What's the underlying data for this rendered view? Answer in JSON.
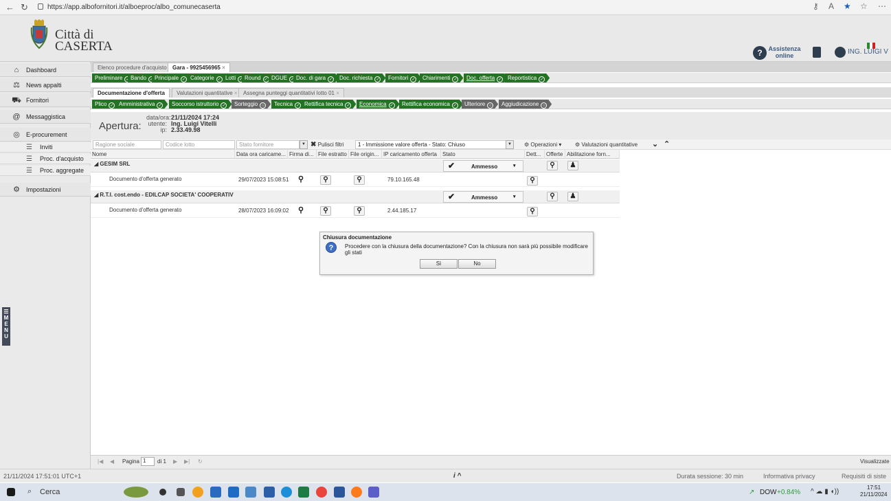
{
  "browser": {
    "url": "https://app.alboformitori.it/alboeproc/albo_comunecaserta",
    "url_display": "https://app.albofornitori.it/alboeproc/albo_comunecaserta"
  },
  "header": {
    "city_line1": "Città di",
    "city_line2": "CASERTA",
    "help_line1": "Assistenza",
    "help_line2": "online",
    "user": "ING. LUIGI V"
  },
  "sidebar": {
    "items": [
      {
        "label": "Dashboard",
        "icon": "home-icon"
      },
      {
        "label": "News appalti",
        "icon": "scales-icon"
      },
      {
        "label": "Fornitori",
        "icon": "truck-icon"
      },
      {
        "label": "Messaggistica",
        "icon": "at-icon"
      },
      {
        "label": "E-procurement",
        "icon": "coins-icon"
      }
    ],
    "subitems": [
      {
        "label": "Inviti"
      },
      {
        "label": "Proc. d'acquisto"
      },
      {
        "label": "Proc. aggregate"
      }
    ],
    "settings": "Impostazioni",
    "menu_tab": "M\nE\nN\nU"
  },
  "tabs1": {
    "t1": "Elenco procedure d'acquisto",
    "t2": "Gara - 9925456965",
    "close": "×"
  },
  "steps1": [
    "Preliminare",
    "Bando",
    "Principale",
    "Categorie",
    "Lotti",
    "Round",
    "DGUE",
    "Doc. di gara",
    "Doc. richiesta",
    "Fornitori",
    "Chiarimenti",
    "Doc. offerta",
    "Reportistica"
  ],
  "tabs2": {
    "t1": "Documentazione d'offerta",
    "t2": "Valutazioni quantitative",
    "t3": "Assegna punteggi quantitativi lotto 01",
    "close": "×"
  },
  "steps2": [
    "Plico",
    "Amministrativa",
    "Soccorso istruttorio",
    "Sorteggio",
    "Tecnica",
    "Rettifica tecnica",
    "Economica",
    "Rettifica economica",
    "Ulteriore",
    "Aggiudicazione"
  ],
  "apertura": {
    "label": "Apertura:",
    "k1": "data/ora:",
    "v1": "21/11/2024 17:24",
    "k2": "utente:",
    "v2": "Ing. Luigi Vitelli",
    "k3": "ip:",
    "v3": "2.33.49.98"
  },
  "filters": {
    "ragione": "Ragione sociale",
    "codice": "Codice lotto",
    "stato": "Stato fornitore",
    "pulisci": "Pulisci filtri",
    "fase": "1 - Immissione valore offerta - Stato: Chiuso",
    "operazioni": "Operazioni",
    "valutazioni": "Valutazioni quantitative"
  },
  "columns": [
    "Nome",
    "Data ora caricame...",
    "Firma di...",
    "File estratto",
    "File origin...",
    "IP caricamento offerta",
    "Stato",
    "Dett...",
    "Offerte",
    "Abilitazione forn..."
  ],
  "groups": [
    {
      "title": "GESIM SRL",
      "status": "Ammesso",
      "doc": "Documento d'offerta generato",
      "date": "29/07/2023 15:08:51",
      "ip": "79.10.165.48"
    },
    {
      "title": "R.T.I. cost.endo - EDILCAP SOCIETA' COOPERATIV",
      "status": "Ammesso",
      "doc": "Documento d'offerta generato",
      "date": "28/07/2023 16:09:02",
      "ip": "2.44.185.17"
    }
  ],
  "dialog": {
    "title": "Chiusura documentazione",
    "text": "Procedere con la chiusura della documentazione? Con la chiusura non sarà più possibile modificare gli stati",
    "yes": "Sì",
    "no": "No"
  },
  "pager": {
    "pagina": "Pagina",
    "page": "1",
    "di": "di 1",
    "visual": "Visualizzate"
  },
  "status": {
    "timestamp": "21/11/2024 17:51:01 UTC+1",
    "info": "i",
    "durata": "Durata sessione: 30 min",
    "privacy": "Informativa privacy",
    "requisiti": "Requisiti di siste"
  },
  "taskbar": {
    "search": "Cerca",
    "dow": "DOW",
    "dow_change": "+0.84%",
    "time": "17:51",
    "date": "21/11/2024"
  },
  "colors": {
    "step_green": "#247224",
    "step_gray": "#676767",
    "accent": "#2e3e4f"
  }
}
